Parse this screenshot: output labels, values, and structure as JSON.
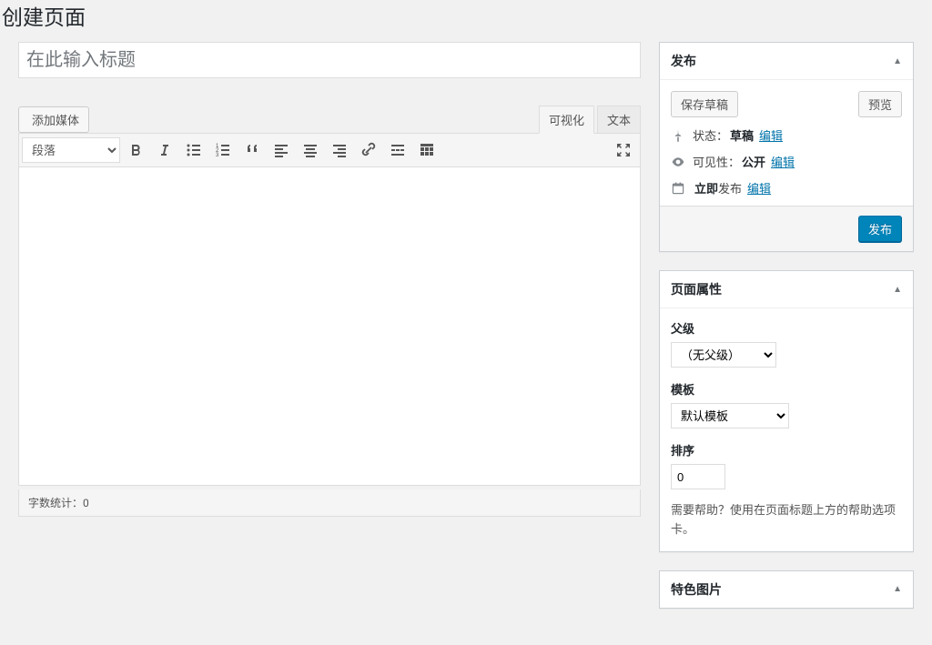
{
  "page": {
    "title": "创建页面"
  },
  "editor": {
    "title_placeholder": "在此输入标题",
    "add_media_label": "添加媒体",
    "tab_visual": "可视化",
    "tab_text": "文本",
    "format_select": "段落",
    "word_count_label": "字数统计：",
    "word_count_value": "0"
  },
  "publish": {
    "header": "发布",
    "save_draft": "保存草稿",
    "preview": "预览",
    "status_label": "状态：",
    "status_value": "草稿",
    "visibility_label": "可见性：",
    "visibility_value": "公开",
    "schedule_label": "立即",
    "schedule_suffix": "发布",
    "edit_link": "编辑",
    "submit": "发布"
  },
  "attributes": {
    "header": "页面属性",
    "parent_label": "父级",
    "parent_value": "（无父级）",
    "template_label": "模板",
    "template_value": "默认模板",
    "order_label": "排序",
    "order_value": "0",
    "help_text": "需要帮助？使用在页面标题上方的帮助选项卡。"
  },
  "featured": {
    "header": "特色图片"
  }
}
